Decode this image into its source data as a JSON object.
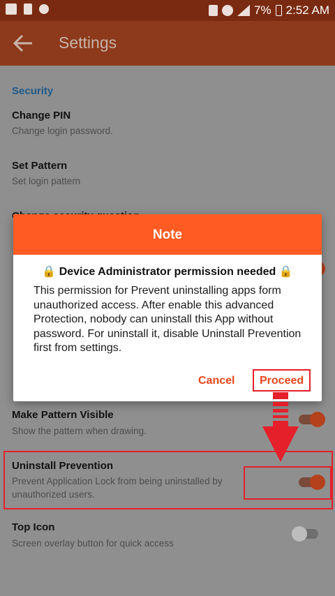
{
  "status_bar": {
    "battery_percent": "7%",
    "time": "2:52 AM",
    "icons": [
      "gallery-icon",
      "app-icon",
      "fingerprint-icon",
      "lock-icon",
      "alarm-icon",
      "signal-icon",
      "battery-icon"
    ]
  },
  "app_bar": {
    "back_icon": "arrow-left-icon",
    "title": "Settings"
  },
  "settings": {
    "section_title": "Security",
    "items": [
      {
        "title": "Change PIN",
        "subtitle": "Change login password."
      },
      {
        "title": "Set Pattern",
        "subtitle": "Set login pattern"
      },
      {
        "title": "Change security question",
        "subtitle": ""
      },
      {
        "title": "Make Pattern Visible",
        "subtitle": "Show the pattern when drawing.",
        "toggle": "on"
      },
      {
        "title": "Uninstall Prevention",
        "subtitle": "Prevent Application Lock from being uninstalled by unauthorized users.",
        "toggle": "on"
      },
      {
        "title": "Top Icon",
        "subtitle": "Screen overlay button for quick access",
        "toggle": "off"
      }
    ]
  },
  "dialog": {
    "title": "Note",
    "heading": "🔒 Device Administrator permission needed 🔒",
    "body": "This permission for Prevent uninstalling apps form unauthorized access. After enable this advanced Protection, nobody can uninstall this App without password. For uninstall it, disable Uninstall Prevention first from settings.",
    "cancel_label": "Cancel",
    "proceed_label": "Proceed"
  },
  "colors": {
    "accent": "#ff5b22",
    "annotation_red": "#e5202a",
    "section_blue": "#1f5a8a"
  }
}
